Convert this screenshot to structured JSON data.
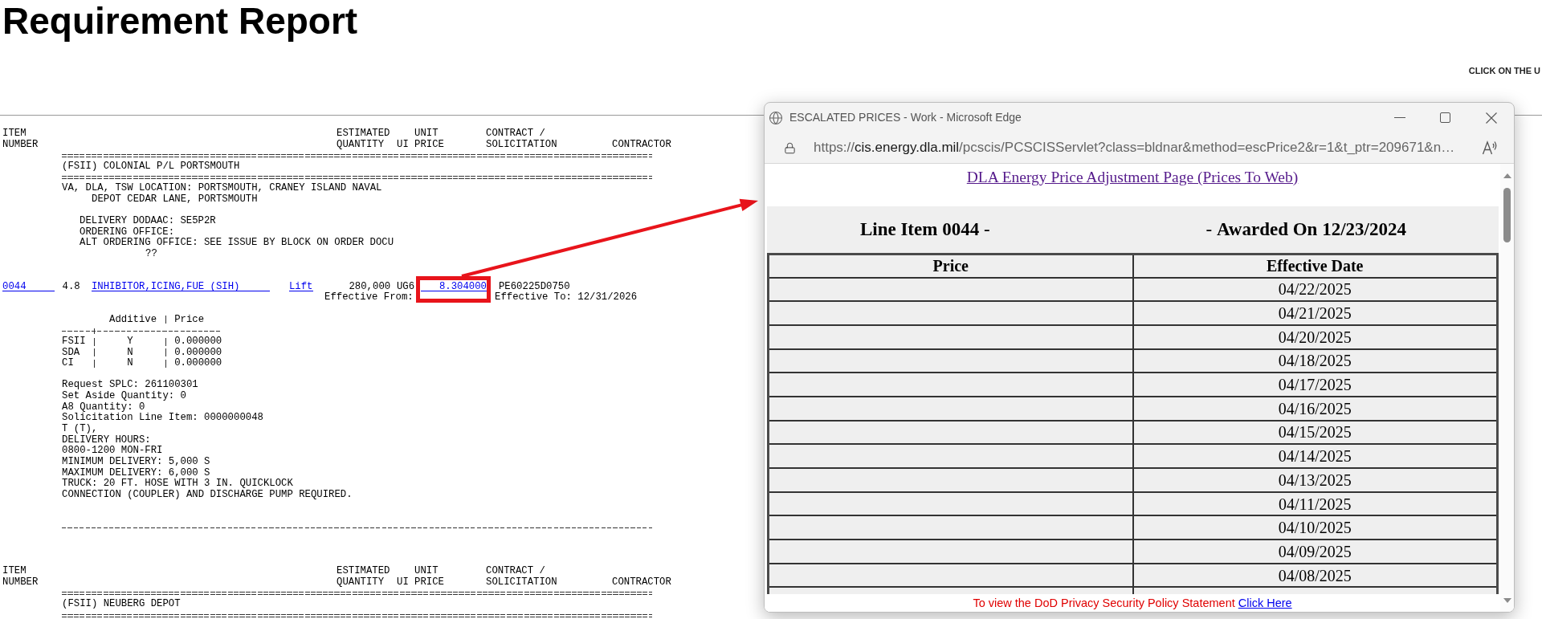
{
  "page": {
    "title": "Requirement Report",
    "notice": "CLICK ON THE U"
  },
  "sections": [
    {
      "header": {
        "columns": [
          {
            "lines": [
              "ITEM",
              "NUMBER"
            ]
          },
          {
            "lines": [
              "ESTIMATED",
              "QUANTITY"
            ]
          },
          {
            "lines": [
              "UI"
            ]
          },
          {
            "lines": [
              "UNIT",
              "PRICE"
            ]
          },
          {
            "lines": [
              "CONTRACT /",
              "SOLICITATION"
            ]
          },
          {
            "lines": [
              "CONTRACTOR"
            ]
          }
        ]
      },
      "location": "(FSII) COLONIAL P/L PORTSMOUTH",
      "address": {
        "lines": [
          "VA, DLA, TSW LOCATION: PORTSMOUTH, CRANEY ISLAND NAVAL",
          "DEPOT CEDAR LANE, PORTSMOUTH"
        ]
      },
      "delivery_lines": [
        "DELIVERY DODAAC: SE5P2R",
        "ORDERING OFFICE:",
        "ALT ORDERING OFFICE: SEE ISSUE BY BLOCK ON ORDER DOCU"
      ],
      "delivery_continuation": "??",
      "item": {
        "number": "0044",
        "column_2": "4.8",
        "description": "INHIBITOR,ICING,FUE (SIH)",
        "lift_link": "Lift",
        "quantity": "280,000",
        "ui": "UG6",
        "unit_price": "8.304000",
        "unit_price_highlighted": true,
        "contract": "PE60225D0750",
        "effective_from": "Effective From:",
        "effective_to": "Effective To: 12/31/2026"
      },
      "additives": {
        "columns": [
          "Additive",
          "Price"
        ],
        "rows": [
          {
            "name": "FSII",
            "flag": "Y",
            "price": "0.000000"
          },
          {
            "name": "SDA",
            "flag": "N",
            "price": "0.000000"
          },
          {
            "name": "CI",
            "flag": "N",
            "price": "0.000000"
          }
        ]
      },
      "details": [
        {
          "lines": [
            "Request SPLC: 261100301"
          ]
        },
        {
          "lines": [
            "Set Aside Quantity: 0"
          ]
        },
        {
          "lines": [
            "A8 Quantity: 0"
          ]
        },
        {
          "lines": [
            "Solicitation Line Item: 0000000048"
          ]
        },
        {
          "lines": [
            "T (T),"
          ]
        },
        {
          "lines": [
            "DELIVERY HOURS:"
          ]
        },
        {
          "lines": [
            "0800-1200 MON-FRI"
          ]
        },
        {
          "lines": [
            "MINIMUM DELIVERY: 5,000 S"
          ]
        },
        {
          "lines": [
            "MAXIMUM DELIVERY: 6,000 S"
          ]
        },
        {
          "lines": [
            "TRUCK: 20 FT. HOSE WITH 3 IN. QUICKLOCK",
            "CONNECTION (COUPLER) AND DISCHARGE PUMP REQUIRED."
          ]
        }
      ]
    },
    {
      "header": {
        "columns": [
          {
            "lines": [
              "ITEM",
              "NUMBER"
            ]
          },
          {
            "lines": [
              "ESTIMATED",
              "QUANTITY"
            ]
          },
          {
            "lines": [
              "UI"
            ]
          },
          {
            "lines": [
              "UNIT",
              "PRICE"
            ]
          },
          {
            "lines": [
              "CONTRACT /",
              "SOLICITATION"
            ]
          },
          {
            "lines": [
              "CONTRACTOR"
            ]
          }
        ]
      },
      "location": "(FSII) NEUBERG DEPOT"
    }
  ],
  "popup": {
    "title": "ESCALATED PRICES - Work - Microsoft Edge",
    "url": {
      "scheme": "https://",
      "host": "cis.energy.dla.mil",
      "path": "/pcscis/PCSCISServlet?class=bldnar&method=escPrice2&r=1&t_ptr=209671&n…"
    },
    "page_link": {
      "text": "DLA Energy Price Adjustment Page (Prices To Web)",
      "visited": true
    },
    "line_item": "**Line Item 0044** -",
    "awarded": "- **Awarded On 12/23/2024**",
    "table": {
      "columns": [
        "Price",
        "Effective Date"
      ],
      "rows": [
        {
          "effective_date": "04/22/2025"
        },
        {
          "effective_date": "04/21/2025"
        },
        {
          "effective_date": "04/20/2025"
        },
        {
          "effective_date": "04/18/2025"
        },
        {
          "effective_date": "04/17/2025"
        },
        {
          "effective_date": "04/16/2025"
        },
        {
          "effective_date": "04/15/2025"
        },
        {
          "effective_date": "04/14/2025"
        },
        {
          "effective_date": "04/13/2025"
        },
        {
          "effective_date": "04/11/2025"
        },
        {
          "effective_date": "04/10/2025"
        },
        {
          "effective_date": "04/09/2025"
        },
        {
          "effective_date": "04/08/2025"
        }
      ]
    },
    "footer": {
      "text": "To view the DoD Privacy Security Policy Statement",
      "link": "Click Here"
    }
  }
}
